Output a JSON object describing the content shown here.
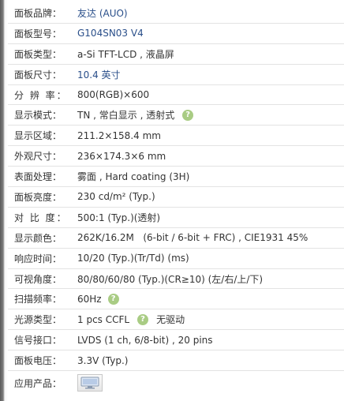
{
  "specs": {
    "brand": {
      "label": "面板品牌：",
      "value": "友达 (AUO)"
    },
    "model": {
      "label": "面板型号：",
      "value": "G104SN03 V4"
    },
    "panel_type": {
      "label": "面板类型：",
      "value": "a-Si TFT-LCD , 液晶屏"
    },
    "size": {
      "label": "面板尺寸：",
      "value": "10.4 英寸"
    },
    "resolution": {
      "label": "分 辨 率：",
      "value": "800(RGB)×600"
    },
    "display_mode": {
      "label": "显示模式：",
      "value": "TN , 常白显示 , 透射式"
    },
    "active_area": {
      "label": "显示区域：",
      "value": "211.2×158.4 mm"
    },
    "outline": {
      "label": "外观尺寸：",
      "value": "236×174.3×6 mm"
    },
    "surface": {
      "label": "表面处理：",
      "value": "雾面 , Hard coating (3H)"
    },
    "brightness": {
      "label": "面板亮度：",
      "value": "230 cd/m² (Typ.)"
    },
    "contrast": {
      "label": "对 比 度：",
      "value": "500:1 (Typ.)(透射)"
    },
    "colors": {
      "label": "显示颜色：",
      "value": "262K/16.2M   (6-bit / 6-bit + FRC) , CIE1931 45%"
    },
    "response": {
      "label": "响应时间：",
      "value": "10/20 (Typ.)(Tr/Td) (ms)"
    },
    "viewing_angle": {
      "label": "可视角度：",
      "value": "80/80/60/80 (Typ.)(CR≥10) (左/右/上/下)"
    },
    "frequency": {
      "label": "扫描频率：",
      "value": "60Hz"
    },
    "backlight": {
      "label": "光源类型：",
      "value": "1 pcs CCFL",
      "extra": "无驱动"
    },
    "interface": {
      "label": "信号接口：",
      "value": "LVDS (1 ch, 6/8-bit) , 20 pins"
    },
    "voltage": {
      "label": "面板电压：",
      "value": "3.3V (Typ.)"
    },
    "application": {
      "label": "应用产品："
    }
  },
  "icons": {
    "help": "question-mark-icon",
    "product": "monitor-icon"
  },
  "colors": {
    "link": "#2a4f8a",
    "help_icon": "#a9cc84",
    "row_border": "#e3e3e3"
  }
}
